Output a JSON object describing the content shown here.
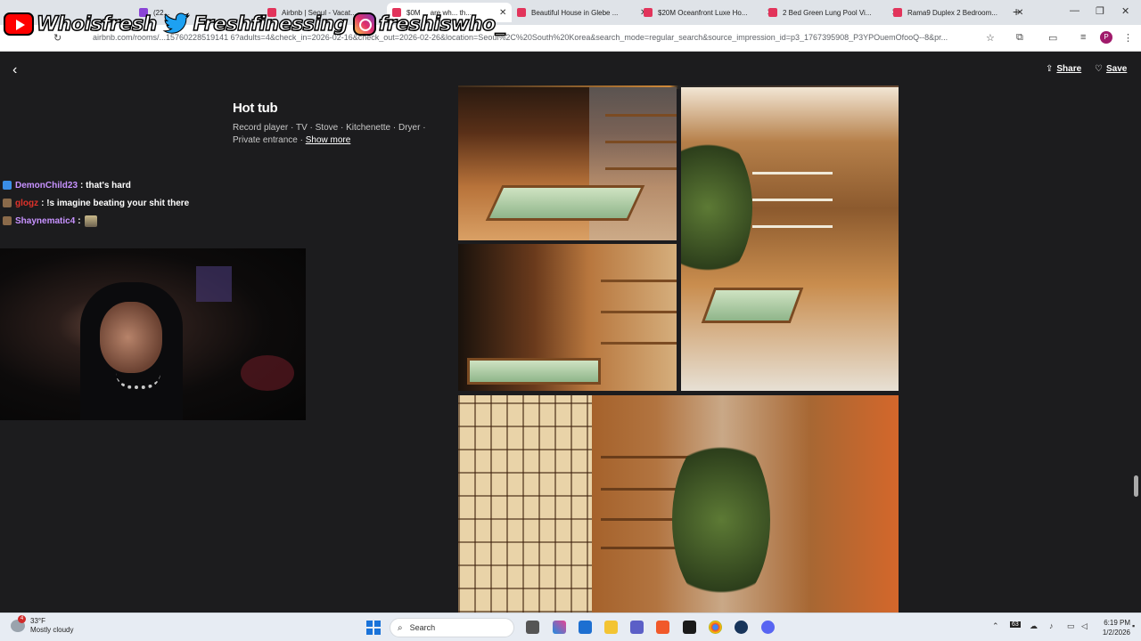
{
  "browser": {
    "tabs": [
      {
        "label": "(22...",
        "active": false
      },
      {
        "label": "Airbnb | Seoul - Vacat...",
        "active": false
      },
      {
        "label": "$0M ... are wh... th...",
        "active": true
      },
      {
        "label": "Beautiful House in Glebe ...",
        "active": false
      },
      {
        "label": "$20M Oceanfront Luxe Ho...",
        "active": false
      },
      {
        "label": "2 Bed Green Lung Pool Vi...",
        "active": false
      },
      {
        "label": "Rama9 Duplex 2 Bedroom...",
        "active": false
      }
    ],
    "new_tab": "+",
    "url": "airbnb.com/rooms/...15760228519141 6?adults=4&check_in=2026-02-16&check_out=2026-02-26&location=Seoul%2C%20South%20Korea&search_mode=regular_search&source_impression_id=p3_1767395908_P3YPOuemOfooQ--8&pr...",
    "profile_initial": "P"
  },
  "overlay": {
    "youtube": "Whoisfresh",
    "twitter": "Freshfinessing",
    "instagram": "freshiswho_"
  },
  "page": {
    "back_icon": "‹",
    "share_label": "Share",
    "save_label": "Save",
    "title": "Hot tub",
    "amenities": "Record player · TV · Stove · Kitchenette · Dryer · Private entrance · ",
    "show_more": "Show more"
  },
  "chat": [
    {
      "user": "DemonChild23",
      "color": "#c792ff",
      "badge": "#3a8ee6",
      "message": "that's hard"
    },
    {
      "user": "glogz",
      "color": "#e0322a",
      "badge": "#8a6a4a",
      "message": "!s imagine beating your shit there"
    },
    {
      "user": "Shaynematic4",
      "color": "#c792ff",
      "badge": "#8a6a4a",
      "message": ""
    }
  ],
  "taskbar": {
    "weather_temp": "33°F",
    "weather_desc": "Mostly cloudy",
    "weather_badge": "4",
    "search_placeholder": "Search",
    "time": "6:19 PM",
    "date": "1/2/2026",
    "tray_num": "63"
  }
}
